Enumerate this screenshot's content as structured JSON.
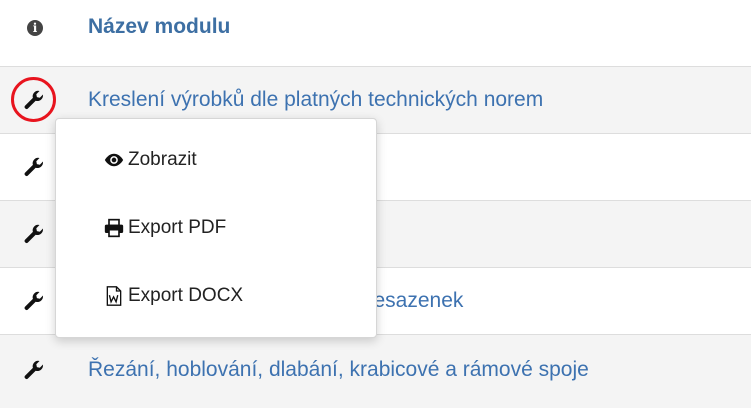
{
  "header": {
    "title": "Název modulu",
    "icon": "info-icon"
  },
  "rows": [
    {
      "label": "Kreslení výrobků dle platných technických norem",
      "icon": "wrench-icon"
    },
    {
      "label": "",
      "icon": "wrench-icon"
    },
    {
      "label": "",
      "icon": "wrench-icon"
    },
    {
      "label": "sesazenek",
      "icon": "wrench-icon"
    },
    {
      "label": "Řezání, hoblování, dlabání, krabicové a rámové spoje",
      "icon": "wrench-icon"
    }
  ],
  "menu": {
    "items": [
      {
        "label": "Zobrazit",
        "icon": "eye-icon"
      },
      {
        "label": "Export PDF",
        "icon": "printer-icon"
      },
      {
        "label": "Export DOCX",
        "icon": "word-file-icon"
      }
    ]
  },
  "colors": {
    "link": "#3d72b0",
    "header": "#3d6fa3",
    "highlight": "#e8141e",
    "stripe": "#f4f4f4"
  }
}
